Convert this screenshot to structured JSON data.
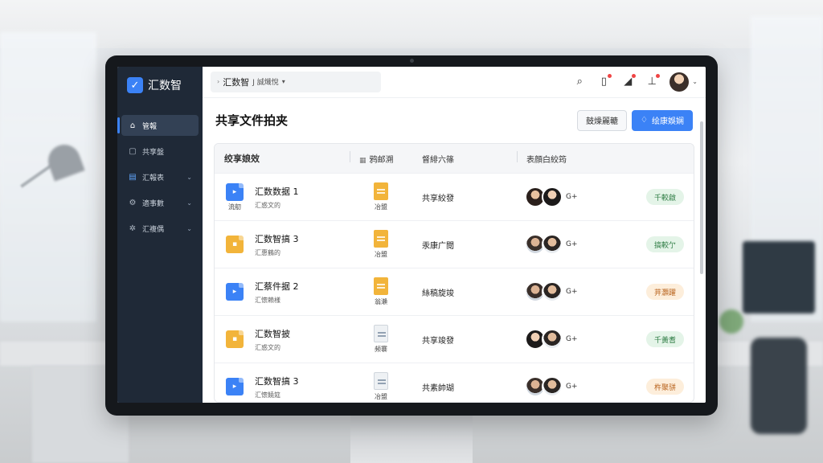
{
  "brand": {
    "name": "汇数智"
  },
  "sidebar": {
    "items": [
      {
        "label": "管報",
        "icon": "home-icon",
        "active": true,
        "chevron": false
      },
      {
        "label": "共享盤",
        "icon": "inbox-icon",
        "active": false,
        "chevron": false
      },
      {
        "label": "汇報表",
        "icon": "document-icon",
        "active": false,
        "chevron": true
      },
      {
        "label": "適事數",
        "icon": "gear-icon",
        "active": false,
        "chevron": true
      },
      {
        "label": "汇複偶",
        "icon": "settings-icon",
        "active": false,
        "chevron": true
      }
    ]
  },
  "topbar": {
    "workspace": "汇数智",
    "workspace_sub": "J 誠熾悅"
  },
  "page": {
    "title": "共享文件拍夹",
    "btn_secondary": "鼓燥麗轆",
    "btn_primary": "绘康娛娴"
  },
  "table": {
    "headers": {
      "name": "绞享娘效",
      "type": "鸦邮溯",
      "owner": "督緋六篠",
      "members": "表顔白絞筠"
    },
    "rows": [
      {
        "name": "汇数数据 1",
        "sub": "汇惑文的",
        "tag": "流舠",
        "type_tag": "冶盟",
        "owner": "共享絞發",
        "more": "G+",
        "badge": "千較啟",
        "badge_color": "green",
        "icon_color": "blue",
        "doc_color": "yellow",
        "avatars": [
          "a",
          "b"
        ]
      },
      {
        "name": "汇数智搞 3",
        "sub": "汇惠鶴的",
        "tag": "",
        "type_tag": "冶盟",
        "owner": "汞康广閲",
        "more": "G+",
        "badge": "搞較亇",
        "badge_color": "green",
        "icon_color": "yellow",
        "doc_color": "yellow",
        "avatars": [
          "c",
          "d"
        ]
      },
      {
        "name": "汇蔡件据 2",
        "sub": "汇懷賴樣",
        "tag": "",
        "type_tag": "翁瀨",
        "owner": "絲稿旋竣",
        "more": "G+",
        "badge": "茾灝躍",
        "badge_color": "orange",
        "icon_color": "blue",
        "doc_color": "yellow",
        "avatars": [
          "c",
          "d"
        ]
      },
      {
        "name": "汇数智披",
        "sub": "汇惑文的",
        "tag": "",
        "type_tag": "频褰",
        "owner": "共享竣發",
        "more": "G+",
        "badge": "千黃耆",
        "badge_color": "green",
        "icon_color": "yellow",
        "doc_color": "gray",
        "avatars": [
          "b",
          "d"
        ]
      },
      {
        "name": "汇数智搞 3",
        "sub": "汇懷饒筵",
        "tag": "",
        "type_tag": "冶盟",
        "owner": "共素帥瑚",
        "more": "G+",
        "badge": "杵聚骈",
        "badge_color": "orange",
        "icon_color": "blue",
        "doc_color": "gray",
        "avatars": [
          "c",
          "d"
        ]
      }
    ]
  },
  "colors": {
    "accent": "#3b82f6",
    "sidebar_bg": "#1f2937",
    "badge_green": "#e4f4e8",
    "badge_orange": "#fdeedb"
  }
}
